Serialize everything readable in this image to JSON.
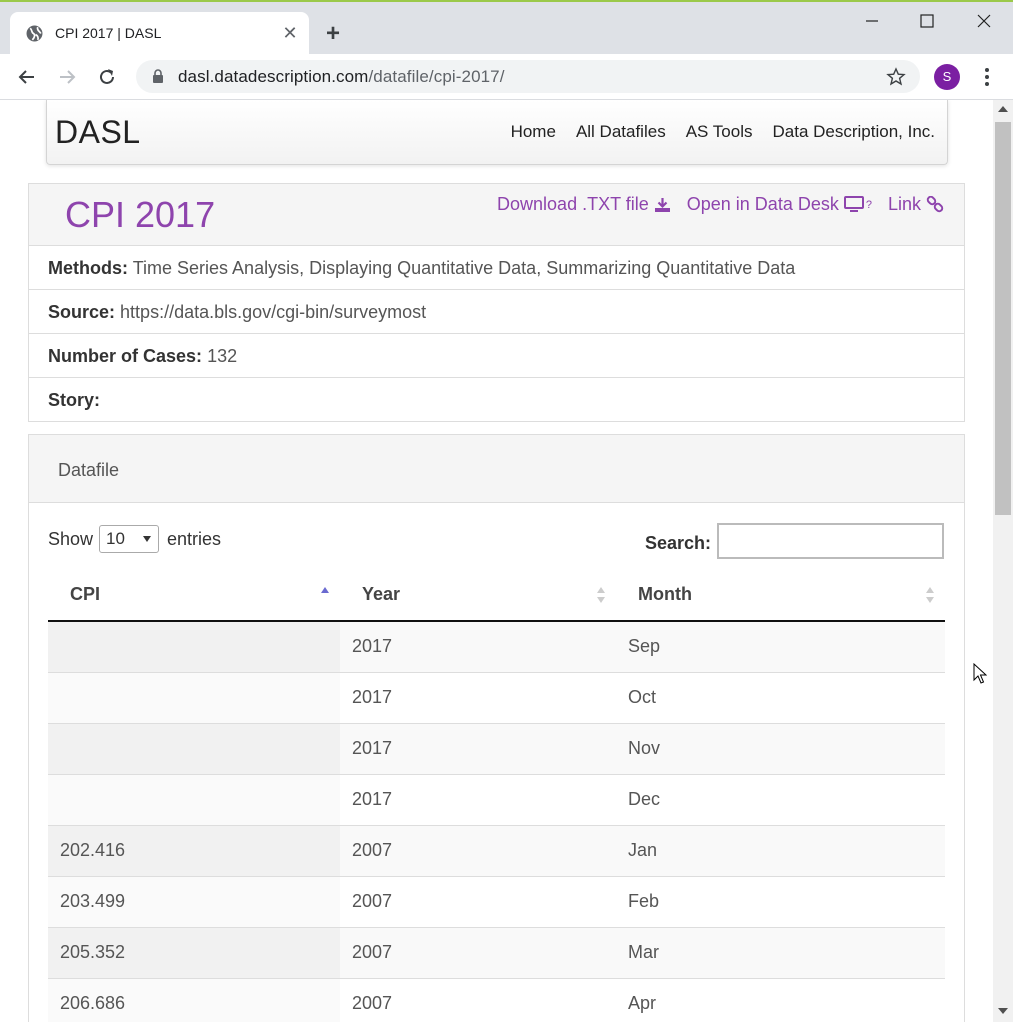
{
  "browser": {
    "tab_title": "CPI 2017 | DASL",
    "url_host": "dasl.datadescription.com",
    "url_path": "/datafile/cpi-2017/",
    "profile_initial": "S"
  },
  "site": {
    "brand": "DASL",
    "nav": [
      "Home",
      "All Datafiles",
      "AS Tools",
      "Data Description, Inc."
    ]
  },
  "dataset": {
    "title": "CPI 2017",
    "actions": {
      "download": "Download .TXT file",
      "open_desk": "Open in Data Desk",
      "open_desk_sup": "?",
      "link": "Link"
    },
    "methods_label": "Methods:",
    "methods_value": "Time Series Analysis, Displaying Quantitative Data, Summarizing Quantitative Data",
    "source_label": "Source:",
    "source_value": "https://data.bls.gov/cgi-bin/surveymost",
    "cases_label": "Number of Cases:",
    "cases_value": "132",
    "story_label": "Story:"
  },
  "datafile": {
    "heading": "Datafile",
    "show_label": "Show",
    "entries_value": "10",
    "entries_label": "entries",
    "search_label": "Search:",
    "search_value": "",
    "columns": [
      "CPI",
      "Year",
      "Month"
    ],
    "sorted_column": "CPI",
    "rows": [
      {
        "cpi": "",
        "year": "2017",
        "month": "Sep"
      },
      {
        "cpi": "",
        "year": "2017",
        "month": "Oct"
      },
      {
        "cpi": "",
        "year": "2017",
        "month": "Nov"
      },
      {
        "cpi": "",
        "year": "2017",
        "month": "Dec"
      },
      {
        "cpi": "202.416",
        "year": "2007",
        "month": "Jan"
      },
      {
        "cpi": "203.499",
        "year": "2007",
        "month": "Feb"
      },
      {
        "cpi": "205.352",
        "year": "2007",
        "month": "Mar"
      },
      {
        "cpi": "206.686",
        "year": "2007",
        "month": "Apr"
      }
    ]
  },
  "colors": {
    "accent": "#8e44ad",
    "sort_active": "#6a6ad0"
  }
}
